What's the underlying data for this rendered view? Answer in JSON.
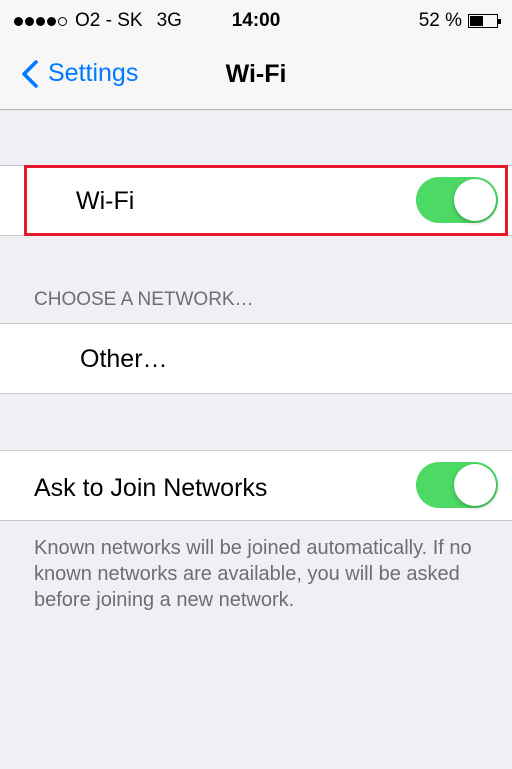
{
  "status_bar": {
    "signal_bars": 4,
    "signal_total": 5,
    "carrier": "O2 - SK",
    "network_type": "3G",
    "time": "14:00",
    "battery_text": "52 %",
    "battery_level": 0.52
  },
  "nav_bar": {
    "back_label": "Settings",
    "title": "Wi-Fi"
  },
  "wifi_cell": {
    "label": "Wi-Fi",
    "enabled": true
  },
  "network_section": {
    "header": "CHOOSE A NETWORK…",
    "other_label": "Other…"
  },
  "ask_cell": {
    "label": "Ask to Join Networks",
    "enabled": true,
    "footer": "Known networks will be joined automatically. If no known networks are available, you will be asked before joining a new network."
  },
  "colors": {
    "accent": "#007aff",
    "toggle_on": "#4cd964",
    "highlight": "#e8192c"
  }
}
